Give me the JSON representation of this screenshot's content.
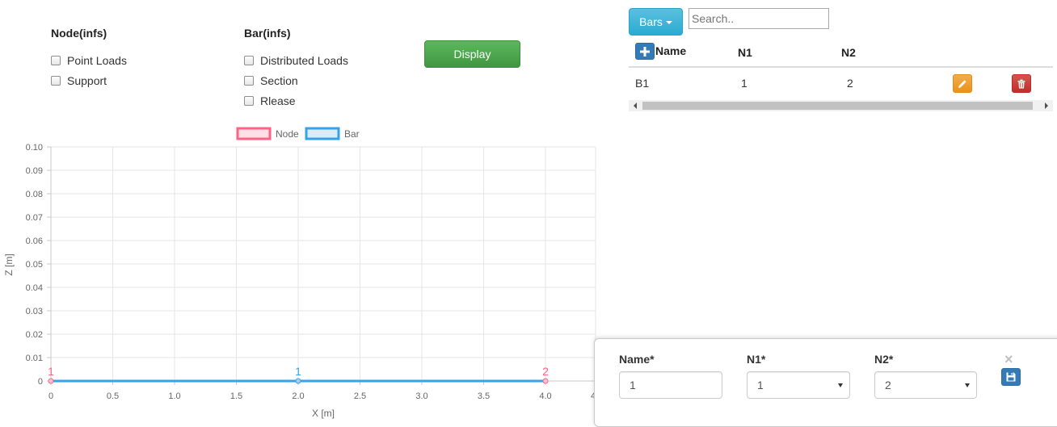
{
  "filters": {
    "node_heading": "Node(infs)",
    "node_options": [
      "Point Loads",
      "Support"
    ],
    "bar_heading": "Bar(infs)",
    "bar_options": [
      "Distributed Loads",
      "Section",
      "Rlease"
    ],
    "display_label": "Display"
  },
  "table": {
    "dropdown_label": "Bars",
    "search_placeholder": "Search..",
    "columns": [
      "Name",
      "N1",
      "N2"
    ],
    "rows": [
      {
        "name": "B1",
        "n1": "1",
        "n2": "2"
      }
    ]
  },
  "form": {
    "name_label": "Name*",
    "name_value": "1",
    "n1_label": "N1*",
    "n1_value": "1",
    "n2_label": "N2*",
    "n2_value": "2",
    "close_glyph": "×"
  },
  "colors": {
    "node": "#ff6384",
    "bar": "#36a2eb",
    "display_button": "#5cb85c",
    "bars_button": "#5bc0de",
    "edit_button": "#f0ad4e",
    "delete_button": "#d9534f",
    "primary": "#337ab7"
  },
  "chart_data": {
    "type": "scatter",
    "xlabel": "X [m]",
    "ylabel": "Z [m]",
    "xlim": [
      0,
      4
    ],
    "ylim": [
      0,
      0.1
    ],
    "x_ticks": [
      "0",
      "0.5",
      "1.0",
      "1.5",
      "2.0",
      "2.5",
      "3.0",
      "3.5",
      "4.0",
      "4"
    ],
    "y_ticks": [
      "0",
      "0.01",
      "0.02",
      "0.03",
      "0.04",
      "0.05",
      "0.06",
      "0.07",
      "0.08",
      "0.09",
      "0.10"
    ],
    "grid": true,
    "legend_position": "top",
    "series": [
      {
        "name": "Node",
        "points": [
          {
            "x": 0,
            "y": 0,
            "label": "1"
          },
          {
            "x": 4,
            "y": 0,
            "label": "2"
          }
        ]
      },
      {
        "name": "Bar",
        "points": [
          {
            "x": 0,
            "y": 0
          },
          {
            "x": 4,
            "y": 0
          }
        ],
        "midpoint_labels": [
          {
            "x": 2,
            "y": 0,
            "label": "1"
          }
        ]
      }
    ]
  }
}
